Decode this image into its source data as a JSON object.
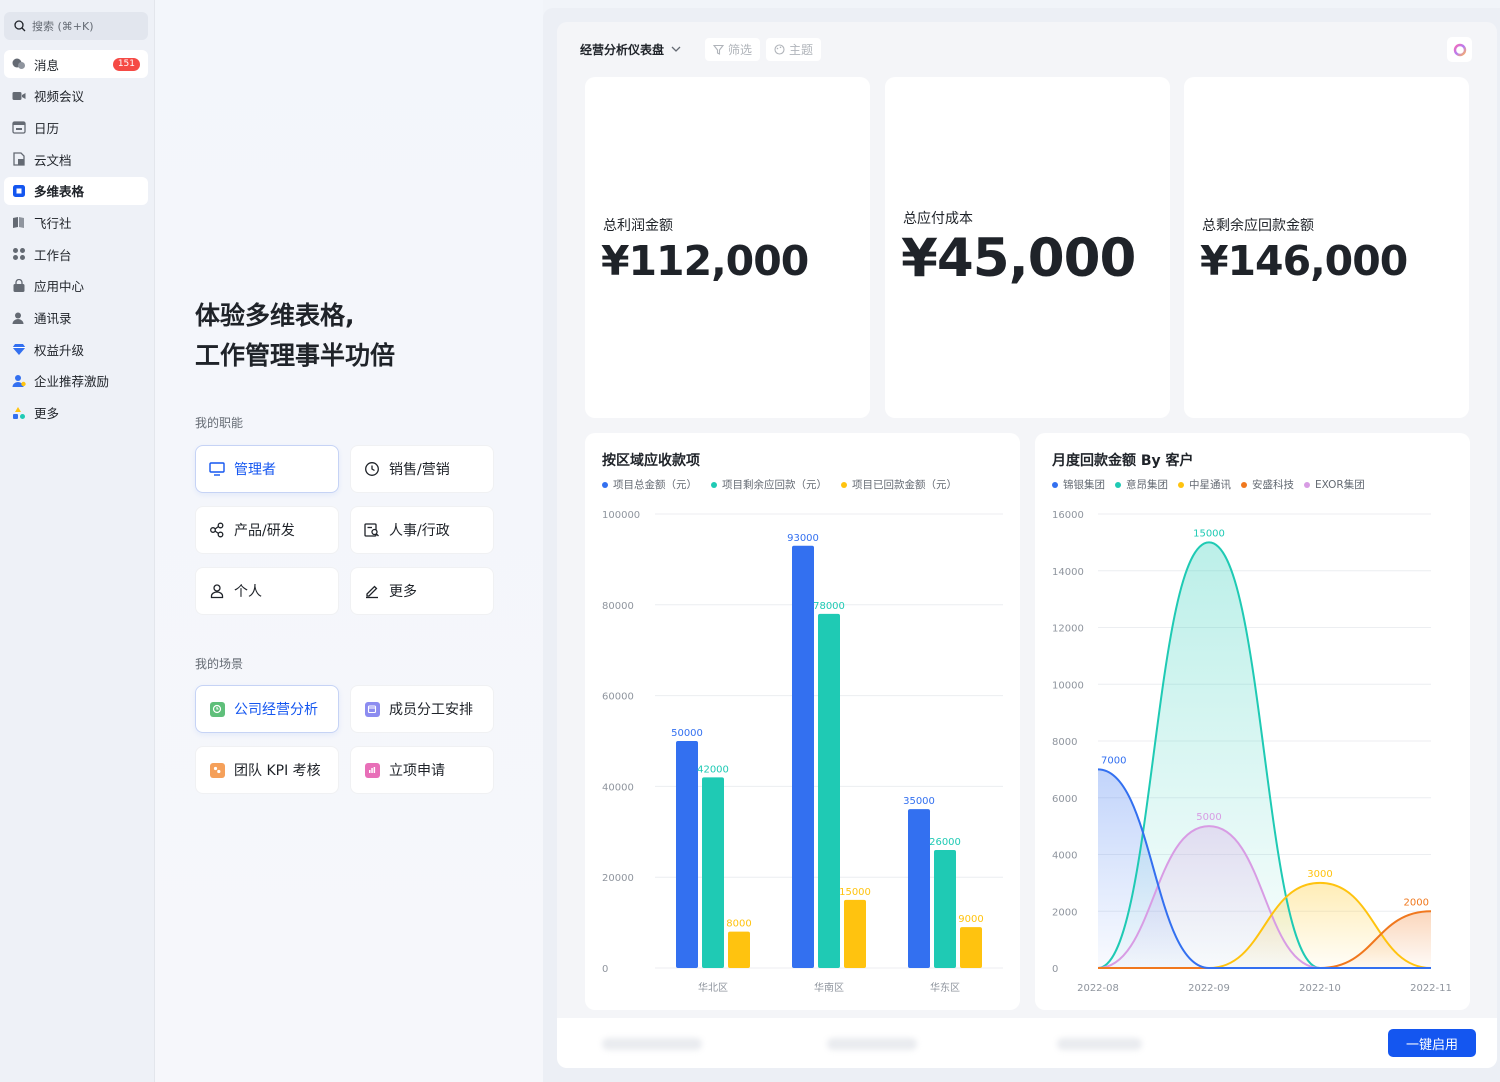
{
  "sidebar": {
    "search_placeholder": "搜索 (⌘+K)",
    "items": [
      {
        "label": "消息",
        "icon": "message-icon",
        "badge": "151"
      },
      {
        "label": "视频会议",
        "icon": "video-icon"
      },
      {
        "label": "日历",
        "icon": "calendar-icon"
      },
      {
        "label": "云文档",
        "icon": "doc-icon"
      },
      {
        "label": "多维表格",
        "icon": "base-icon"
      },
      {
        "label": "飞行社",
        "icon": "book-icon"
      },
      {
        "label": "工作台",
        "icon": "workbench-icon"
      },
      {
        "label": "应用中心",
        "icon": "app-center-icon"
      },
      {
        "label": "通讯录",
        "icon": "contacts-icon"
      },
      {
        "label": "权益升级",
        "icon": "diamond-icon"
      },
      {
        "label": "企业推荐激励",
        "icon": "referral-icon"
      },
      {
        "label": "更多",
        "icon": "more-apps-icon"
      }
    ]
  },
  "middle": {
    "headline_line1": "体验多维表格,",
    "headline_line2": "工作管理事半功倍",
    "roles_label": "我的职能",
    "roles": [
      "管理者",
      "销售/营销",
      "产品/研发",
      "人事/行政",
      "个人",
      "更多"
    ],
    "scenes_label": "我的场景",
    "scenes": [
      "公司经营分析",
      "成员分工安排",
      "团队 KPI 考核",
      "立项申请"
    ]
  },
  "dashboard": {
    "title": "经营分析仪表盘",
    "filter_label": "筛选",
    "theme_label": "主题",
    "kpis": [
      {
        "label": "总利润金额",
        "value": "¥112,000"
      },
      {
        "label": "总应付成本",
        "value": "¥45,000"
      },
      {
        "label": "总剩余应回款金额",
        "value": "¥146,000"
      }
    ],
    "enable_button": "一键启用"
  },
  "colors": {
    "blue": "#3370f0",
    "teal": "#1fcab4",
    "yellow": "#ffc30f",
    "orange": "#f0781e",
    "purple": "#d89ce4",
    "primary": "#1456f0"
  },
  "chart_data": [
    {
      "type": "bar",
      "title": "按区域应收款项",
      "categories": [
        "华北区",
        "华南区",
        "华东区"
      ],
      "series": [
        {
          "name": "项目总金额（元）",
          "values": [
            50000,
            93000,
            35000
          ]
        },
        {
          "name": "项目剩余应回款（元）",
          "values": [
            42000,
            78000,
            26000
          ]
        },
        {
          "name": "项目已回款金额（元）",
          "values": [
            8000,
            15000,
            9000
          ]
        }
      ],
      "ylim": [
        0,
        100000
      ],
      "yticks": [
        0,
        20000,
        40000,
        60000,
        80000,
        100000
      ],
      "grid": true,
      "legend": "top-left"
    },
    {
      "type": "area",
      "title": "月度回款金额 By 客户",
      "x": [
        "2022-08",
        "2022-09",
        "2022-10",
        "2022-11"
      ],
      "series": [
        {
          "name": "锦银集团",
          "values": [
            7000,
            0,
            0,
            0
          ]
        },
        {
          "name": "意昂集团",
          "values": [
            0,
            15000,
            0,
            0
          ]
        },
        {
          "name": "中星通讯",
          "values": [
            0,
            0,
            3000,
            0
          ]
        },
        {
          "name": "安盛科技",
          "values": [
            0,
            0,
            0,
            2000
          ]
        },
        {
          "name": "EXOR集团",
          "values": [
            0,
            5000,
            0,
            0
          ]
        }
      ],
      "ylim": [
        0,
        16000
      ],
      "yticks": [
        0,
        2000,
        4000,
        6000,
        8000,
        10000,
        12000,
        14000,
        16000
      ],
      "grid": true,
      "legend": "top-left"
    }
  ]
}
